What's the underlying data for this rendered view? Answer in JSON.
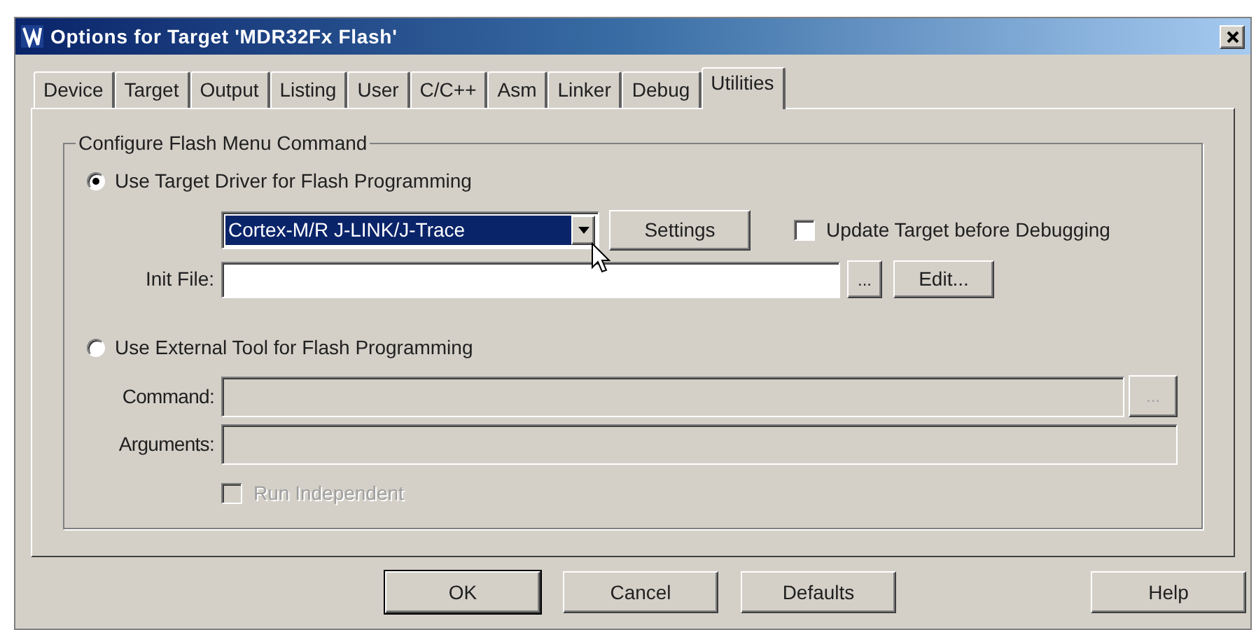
{
  "window": {
    "title": "Options for Target 'MDR32Fx Flash'"
  },
  "tabs": [
    {
      "label": "Device",
      "selected": false
    },
    {
      "label": "Target",
      "selected": false
    },
    {
      "label": "Output",
      "selected": false
    },
    {
      "label": "Listing",
      "selected": false
    },
    {
      "label": "User",
      "selected": false
    },
    {
      "label": "C/C++",
      "selected": false
    },
    {
      "label": "Asm",
      "selected": false
    },
    {
      "label": "Linker",
      "selected": false
    },
    {
      "label": "Debug",
      "selected": false
    },
    {
      "label": "Utilities",
      "selected": true
    }
  ],
  "flash_menu": {
    "title": "Configure Flash Menu Command",
    "target_driver": {
      "label": "Use Target Driver for Flash Programming",
      "selected": true,
      "driver": "Cortex-M/R J-LINK/J-Trace",
      "settings_button": "Settings",
      "update_target": {
        "label": "Update Target before Debugging",
        "checked": false
      },
      "init_file": {
        "label": "Init File:",
        "browse_button": "...",
        "edit_button": "Edit..."
      }
    },
    "external_tool": {
      "label": "Use External Tool for Flash Programming",
      "selected": false,
      "command": {
        "label": "Command:",
        "browse_button": "...",
        "disabled": true
      },
      "arguments": {
        "label": "Arguments:",
        "disabled": true
      },
      "run_independent": {
        "label": "Run Independent",
        "checked": false,
        "disabled": true
      }
    }
  },
  "buttons": [
    {
      "label": "OK",
      "default": true
    },
    {
      "label": "Cancel",
      "default": false
    },
    {
      "label": "Defaults",
      "default": false
    },
    {
      "label": "Help",
      "default": false
    }
  ]
}
